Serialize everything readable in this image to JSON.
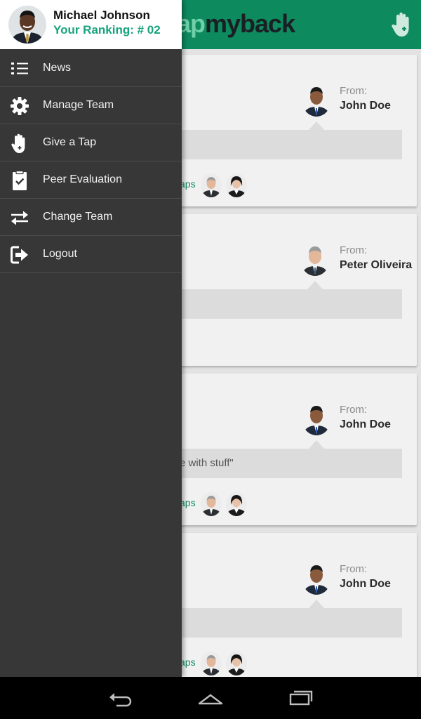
{
  "app": {
    "logo": {
      "part_a": "ap",
      "part_b": "myback"
    },
    "colors": {
      "brand_green": "#0e8a5f",
      "rank_green": "#17a37c",
      "drawer_bg": "#373737"
    }
  },
  "drawer": {
    "profile": {
      "name": "Michael Johnson",
      "ranking": "Your Ranking: # 02"
    },
    "menu": [
      {
        "label": "News",
        "icon": "list-icon"
      },
      {
        "label": "Manage Team",
        "icon": "gear-icon"
      },
      {
        "label": "Give a Tap",
        "icon": "hand-tap-icon"
      },
      {
        "label": "Peer Evaluation",
        "icon": "clipboard-check-icon"
      },
      {
        "label": "Change Team",
        "icon": "swap-arrows-icon"
      },
      {
        "label": "Logout",
        "icon": "logout-icon"
      }
    ]
  },
  "feed": {
    "cards": [
      {
        "from_label": "From:",
        "from_name": "John Doe",
        "message": "",
        "taps_label": "aps"
      },
      {
        "from_label": "From:",
        "from_name": "Peter Oliveira",
        "message": ""
      },
      {
        "from_label": "From:",
        "from_name": "John Doe",
        "message": "e with stuff\"",
        "taps_label": "aps"
      },
      {
        "from_label": "From:",
        "from_name": "John Doe",
        "message": "",
        "taps_label": "aps"
      }
    ]
  }
}
